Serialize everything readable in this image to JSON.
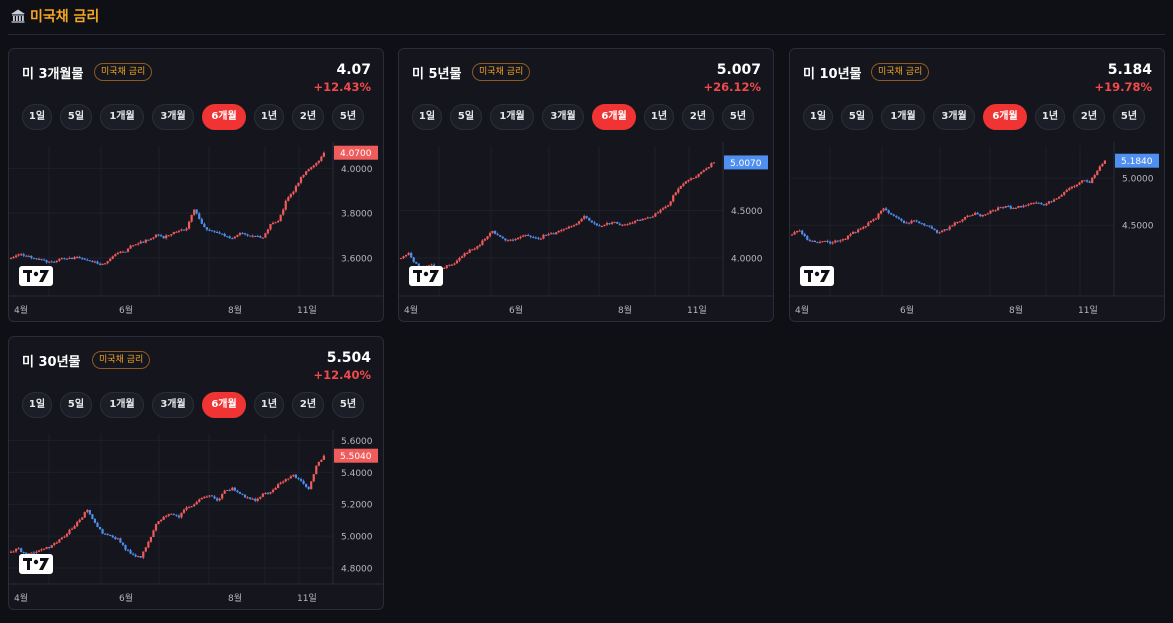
{
  "header": {
    "title": "미국채 금리",
    "icon": "bank-icon",
    "accent": "#f5a623"
  },
  "colors": {
    "up": "#f05b5b",
    "down": "#4f8ff0",
    "active": "#f03434",
    "neutral_label": "#3d8ef0"
  },
  "cards": [
    {
      "name": "미 3개월물",
      "badge": "미국채 금리",
      "value": "4.07",
      "change": "+12.43%",
      "periods": [
        "1일",
        "5일",
        "1개월",
        "3개월",
        "6개월",
        "1년",
        "2년",
        "5년"
      ],
      "active_period": "6개월",
      "chart_data": {
        "type": "candlestick",
        "y_ticks": [
          "4.0000",
          "3.8000",
          "3.6000"
        ],
        "y_tick_values": [
          4.0,
          3.8,
          3.6
        ],
        "ylim": [
          3.43,
          4.1
        ],
        "x_ticks": [
          "4월",
          "6월",
          "8월",
          "11일"
        ],
        "last_label": "4.0700",
        "last_color": "#f05b5b",
        "points": [
          3.6,
          3.62,
          3.61,
          3.6,
          3.59,
          3.58,
          3.59,
          3.6,
          3.6,
          3.6,
          3.59,
          3.58,
          3.57,
          3.6,
          3.62,
          3.63,
          3.66,
          3.67,
          3.68,
          3.7,
          3.69,
          3.71,
          3.72,
          3.73,
          3.82,
          3.75,
          3.72,
          3.71,
          3.7,
          3.69,
          3.71,
          3.7,
          3.7,
          3.69,
          3.75,
          3.76,
          3.85,
          3.9,
          3.96,
          4.0,
          4.02,
          4.07
        ]
      }
    },
    {
      "name": "미 5년물",
      "badge": "미국채 금리",
      "value": "5.007",
      "change": "+26.12%",
      "periods": [
        "1일",
        "5일",
        "1개월",
        "3개월",
        "6개월",
        "1년",
        "2년",
        "5년"
      ],
      "active_period": "6개월",
      "chart_data": {
        "type": "candlestick",
        "y_ticks": [
          "4.5000",
          "4.0000"
        ],
        "y_tick_values": [
          4.5,
          4.0
        ],
        "ylim": [
          3.6,
          5.18
        ],
        "x_ticks": [
          "4월",
          "6월",
          "8월",
          "11일"
        ],
        "last_label": "5.0070",
        "last_color": "#4f8ff0",
        "points": [
          4.0,
          4.05,
          3.93,
          3.9,
          3.92,
          3.88,
          3.92,
          3.95,
          4.02,
          4.08,
          4.12,
          4.2,
          4.28,
          4.22,
          4.18,
          4.2,
          4.24,
          4.22,
          4.2,
          4.25,
          4.26,
          4.3,
          4.32,
          4.36,
          4.44,
          4.38,
          4.34,
          4.36,
          4.38,
          4.35,
          4.37,
          4.4,
          4.42,
          4.44,
          4.5,
          4.56,
          4.7,
          4.78,
          4.84,
          4.88,
          4.95,
          5.007
        ]
      }
    },
    {
      "name": "미 10년물",
      "badge": "미국채 금리",
      "value": "5.184",
      "change": "+19.78%",
      "periods": [
        "1일",
        "5일",
        "1개월",
        "3개월",
        "6개월",
        "1년",
        "2년",
        "5년"
      ],
      "active_period": "6개월",
      "chart_data": {
        "type": "candlestick",
        "y_ticks": [
          "5.0000",
          "4.5000"
        ],
        "y_tick_values": [
          5.0,
          4.5
        ],
        "ylim": [
          3.75,
          5.34
        ],
        "x_ticks": [
          "4월",
          "6월",
          "8월",
          "11일"
        ],
        "last_label": "5.1840",
        "last_color": "#4f8ff0",
        "points": [
          4.4,
          4.45,
          4.34,
          4.32,
          4.34,
          4.3,
          4.34,
          4.36,
          4.42,
          4.47,
          4.52,
          4.58,
          4.68,
          4.62,
          4.56,
          4.52,
          4.55,
          4.52,
          4.48,
          4.43,
          4.45,
          4.5,
          4.55,
          4.6,
          4.62,
          4.6,
          4.65,
          4.68,
          4.7,
          4.68,
          4.7,
          4.72,
          4.74,
          4.72,
          4.76,
          4.8,
          4.88,
          4.92,
          4.98,
          4.95,
          5.08,
          5.184
        ]
      }
    },
    {
      "name": "미 30년물",
      "badge": "미국채 금리",
      "value": "5.504",
      "change": "+12.40%",
      "periods": [
        "1일",
        "5일",
        "1개월",
        "3개월",
        "6개월",
        "1년",
        "2년",
        "5년"
      ],
      "active_period": "6개월",
      "chart_data": {
        "type": "candlestick",
        "y_ticks": [
          "5.6000",
          "5.4000",
          "5.2000",
          "5.0000",
          "4.8000"
        ],
        "y_tick_values": [
          5.6,
          5.4,
          5.2,
          5.0,
          4.8
        ],
        "ylim": [
          4.7,
          5.64
        ],
        "x_ticks": [
          "4월",
          "6월",
          "8월",
          "11일"
        ],
        "last_label": "5.5040",
        "last_color": "#f05b5b",
        "points": [
          4.9,
          4.92,
          4.88,
          4.9,
          4.92,
          4.93,
          4.96,
          5.0,
          5.05,
          5.1,
          5.17,
          5.08,
          5.02,
          5.0,
          4.98,
          4.92,
          4.88,
          4.87,
          4.96,
          5.08,
          5.12,
          5.14,
          5.12,
          5.18,
          5.2,
          5.24,
          5.26,
          5.22,
          5.28,
          5.3,
          5.26,
          5.24,
          5.22,
          5.26,
          5.28,
          5.32,
          5.36,
          5.38,
          5.34,
          5.3,
          5.44,
          5.504
        ]
      }
    }
  ]
}
